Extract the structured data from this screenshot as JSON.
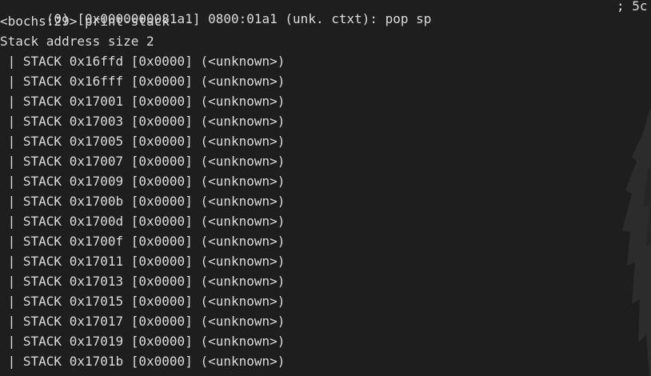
{
  "terminal": {
    "disasm_line": "(0) [0x0000000081a1] 0800:01a1 (unk. ctxt): pop sp",
    "disasm_comment": "; 5c",
    "prompt_line": "<bochs:29> print-stack",
    "stack_header": "Stack address size 2",
    "stack_rows": [
      " | STACK 0x16ffd [0x0000] (<unknown>)",
      " | STACK 0x16fff [0x0000] (<unknown>)",
      " | STACK 0x17001 [0x0000] (<unknown>)",
      " | STACK 0x17003 [0x0000] (<unknown>)",
      " | STACK 0x17005 [0x0000] (<unknown>)",
      " | STACK 0x17007 [0x0000] (<unknown>)",
      " | STACK 0x17009 [0x0000] (<unknown>)",
      " | STACK 0x1700b [0x0000] (<unknown>)",
      " | STACK 0x1700d [0x0000] (<unknown>)",
      " | STACK 0x1700f [0x0000] (<unknown>)",
      " | STACK 0x17011 [0x0000] (<unknown>)",
      " | STACK 0x17013 [0x0000] (<unknown>)",
      " | STACK 0x17015 [0x0000] (<unknown>)",
      " | STACK 0x17017 [0x0000] (<unknown>)",
      " | STACK 0x17019 [0x0000] (<unknown>)",
      " | STACK 0x1701b [0x0000] (<unknown>)"
    ]
  },
  "colors": {
    "background": "#1e1e1f",
    "text": "#dcdcdc",
    "wallpaper_figure": "#2c2c2d"
  }
}
